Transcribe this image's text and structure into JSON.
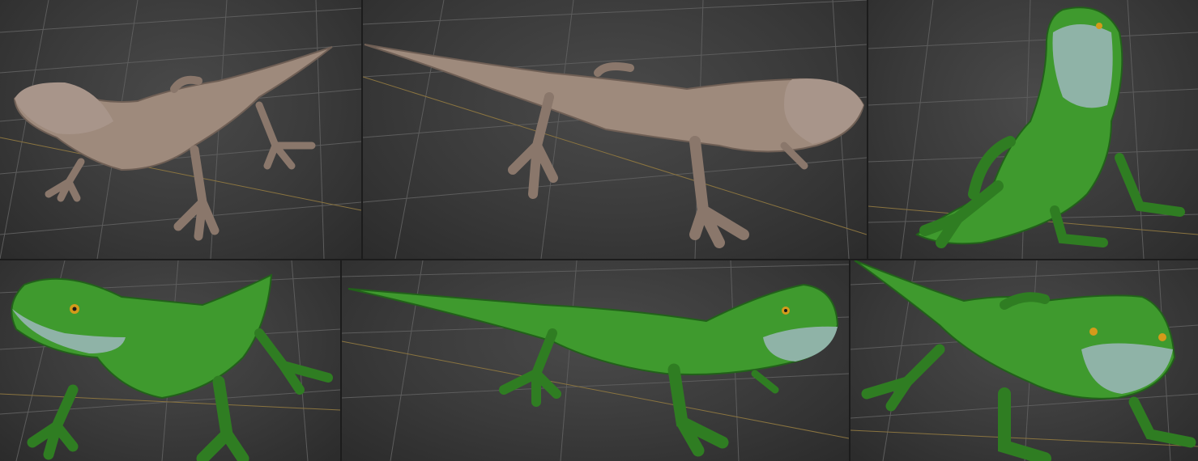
{
  "palette": {
    "background": "#1c1c1c",
    "viewport": "#3a3a3a",
    "grid": "#5d5d5d",
    "axis": "#8a7440",
    "clay": "#9e8a7c",
    "clay_shadow": "#6f5f55",
    "skin_green": "#3f9a2e",
    "skin_dark": "#22611a",
    "skin_throat": "#8fb3a7",
    "eye": "#d49a1a"
  },
  "viewports": [
    {
      "id": "vp-1",
      "material": "clay",
      "pose": "three-quarter-front"
    },
    {
      "id": "vp-2",
      "material": "clay",
      "pose": "side"
    },
    {
      "id": "vp-3",
      "material": "textured",
      "pose": "rearing-up"
    },
    {
      "id": "vp-4",
      "material": "textured",
      "pose": "front-closeup"
    },
    {
      "id": "vp-5",
      "material": "textured",
      "pose": "side"
    },
    {
      "id": "vp-6",
      "material": "textured",
      "pose": "front"
    }
  ]
}
